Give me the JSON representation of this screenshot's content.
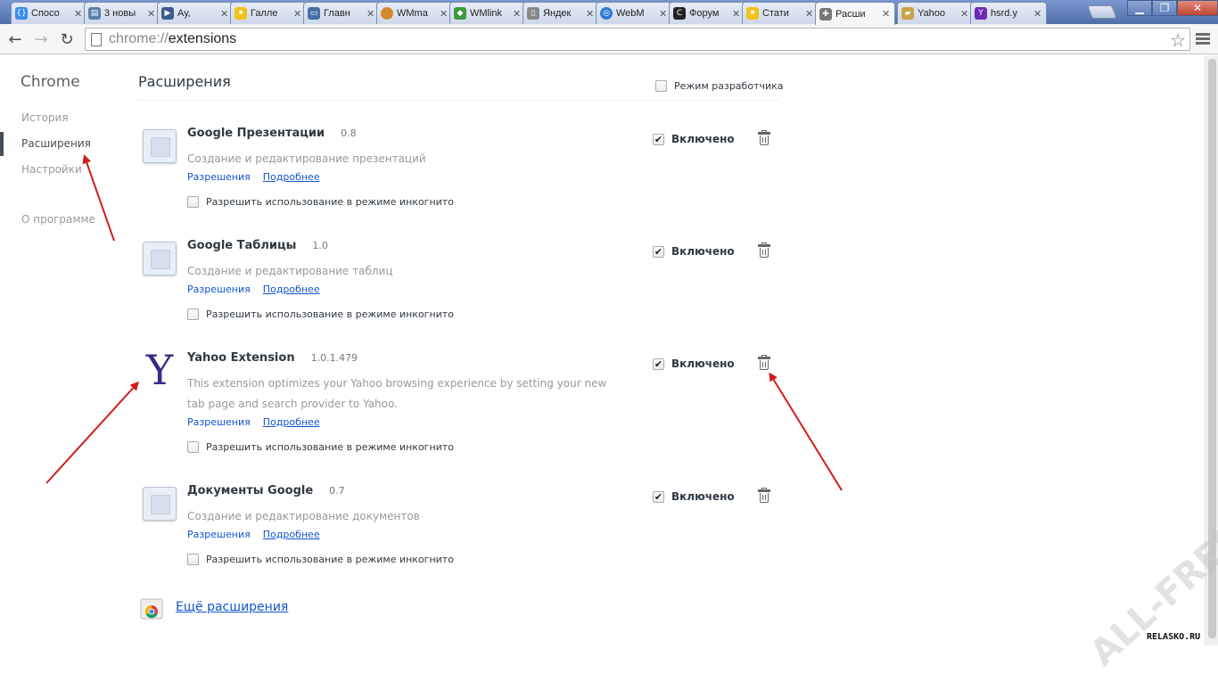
{
  "tabs": [
    {
      "title": "Спосо",
      "icon": "bracket-icon",
      "color": "#3a8ee6"
    },
    {
      "title": "3 новы",
      "icon": "page-icon",
      "color": "#5b7fa8"
    },
    {
      "title": "Ау,",
      "icon": "play-icon",
      "color": "#3a5b8c"
    },
    {
      "title": "Галле",
      "icon": "star-icon",
      "color": "#f2c21b"
    },
    {
      "title": "Главн",
      "icon": "window-icon",
      "color": "#4a6ea8"
    },
    {
      "title": "WMma",
      "icon": "circle-icon",
      "color": "#d4882e"
    },
    {
      "title": "WMlink",
      "icon": "green-icon",
      "color": "#3b9a3b"
    },
    {
      "title": "Яндек",
      "icon": "doc-icon",
      "color": "#888888"
    },
    {
      "title": "WebM",
      "icon": "globe-icon",
      "color": "#2e7bd6"
    },
    {
      "title": "Форум",
      "icon": "c-icon",
      "color": "#222222"
    },
    {
      "title": "Стати",
      "icon": "star-icon",
      "color": "#f2c21b"
    },
    {
      "title": "Расши",
      "icon": "puzzle-icon",
      "color": "#777777"
    },
    {
      "title": "Yahoo",
      "icon": "folder-icon",
      "color": "#c9a24a"
    },
    {
      "title": "hsrd.y",
      "icon": "yahoo-icon",
      "color": "#6b2bb3"
    }
  ],
  "url": {
    "scheme": "chrome://",
    "path": "extensions"
  },
  "sidebar": {
    "brand": "Chrome",
    "items": [
      {
        "label": "История"
      },
      {
        "label": "Расширения"
      },
      {
        "label": "Настройки"
      },
      {
        "label": "О программе"
      }
    ]
  },
  "main": {
    "title": "Расширения",
    "dev_mode_label": "Режим разработчика",
    "extensions": [
      {
        "name": "Google Презентации",
        "version": "0.8",
        "description": "Создание и редактирование презентаций",
        "permissions_link": "Разрешения",
        "details_link": "Подробнее",
        "incognito_label": "Разрешить использование в режиме инкогнито",
        "enabled_label": "Включено"
      },
      {
        "name": "Google Таблицы",
        "version": "1.0",
        "description": "Создание и редактирование таблиц",
        "permissions_link": "Разрешения",
        "details_link": "Подробнее",
        "incognito_label": "Разрешить использование в режиме инкогнито",
        "enabled_label": "Включено"
      },
      {
        "name": "Yahoo Extension",
        "version": "1.0.1.479",
        "description": "This extension optimizes your Yahoo browsing experience by setting your new tab page and search provider to Yahoo.",
        "permissions_link": "Разрешения",
        "details_link": "Подробнее",
        "incognito_label": "Разрешить использование в режиме инкогнито",
        "enabled_label": "Включено"
      },
      {
        "name": "Документы Google",
        "version": "0.7",
        "description": "Создание и редактирование документов",
        "permissions_link": "Разрешения",
        "details_link": "Подробнее",
        "incognito_label": "Разрешить использование в режиме инкогнито",
        "enabled_label": "Включено"
      }
    ],
    "more_link": "Ещё расширения"
  },
  "watermark": {
    "text": "ALL-FREE LOAD",
    "corner": "RELASKO.RU"
  },
  "colors": {
    "accent": "#1155cc",
    "annotation": "#d01b1b",
    "yahoo": "#3b2a83"
  }
}
